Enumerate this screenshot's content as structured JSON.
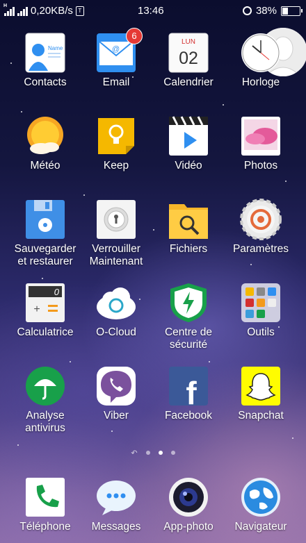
{
  "status_bar": {
    "sim_indicator": "H",
    "speed": "0,20KB/s",
    "time": "13:46",
    "battery_percent": "38%",
    "battery_level": 0.38
  },
  "apps": [
    {
      "label": "Contacts",
      "icon": "contacts-icon",
      "contact_text": "Name"
    },
    {
      "label": "Email",
      "icon": "email-icon",
      "badge": "6"
    },
    {
      "label": "Calendrier",
      "icon": "calendar-icon",
      "day_name": "LUN",
      "day_number": "02"
    },
    {
      "label": "Horloge",
      "icon": "clock-icon"
    },
    {
      "label": "Météo",
      "icon": "weather-icon"
    },
    {
      "label": "Keep",
      "icon": "keep-icon"
    },
    {
      "label": "Vidéo",
      "icon": "video-icon"
    },
    {
      "label": "Photos",
      "icon": "photos-icon"
    },
    {
      "label_line1": "Sauvegarder",
      "label_line2": "et restaurer",
      "icon": "backup-icon"
    },
    {
      "label_line1": "Verrouiller",
      "label_line2": "Maintenant",
      "icon": "lock-icon"
    },
    {
      "label": "Fichiers",
      "icon": "files-icon"
    },
    {
      "label": "Paramètres",
      "icon": "settings-icon"
    },
    {
      "label": "Calculatrice",
      "icon": "calculator-icon",
      "display": "0"
    },
    {
      "label": "O-Cloud",
      "icon": "cloud-icon"
    },
    {
      "label_line1": "Centre de",
      "label_line2": "sécurité",
      "icon": "security-icon"
    },
    {
      "label": "Outils",
      "icon": "tools-folder-icon"
    },
    {
      "label_line1": "Analyse",
      "label_line2": "antivirus",
      "icon": "antivirus-icon"
    },
    {
      "label": "Viber",
      "icon": "viber-icon"
    },
    {
      "label": "Facebook",
      "icon": "facebook-icon",
      "glyph": "f"
    },
    {
      "label": "Snapchat",
      "icon": "snapchat-icon"
    }
  ],
  "dock": [
    {
      "label": "Téléphone",
      "icon": "phone-icon"
    },
    {
      "label": "Messages",
      "icon": "messages-icon"
    },
    {
      "label": "App-photo",
      "icon": "camera-icon"
    },
    {
      "label": "Navigateur",
      "icon": "browser-icon"
    }
  ],
  "pages": {
    "count": 3,
    "active": 2
  },
  "colors": {
    "badge": "#e53935",
    "email": "#2f8ff0",
    "keep": "#f5b800",
    "facebook": "#3b5998",
    "snapchat": "#fffc00",
    "viber": "#7b519d",
    "antivirus": "#18a04a",
    "security": "#18a04a"
  }
}
